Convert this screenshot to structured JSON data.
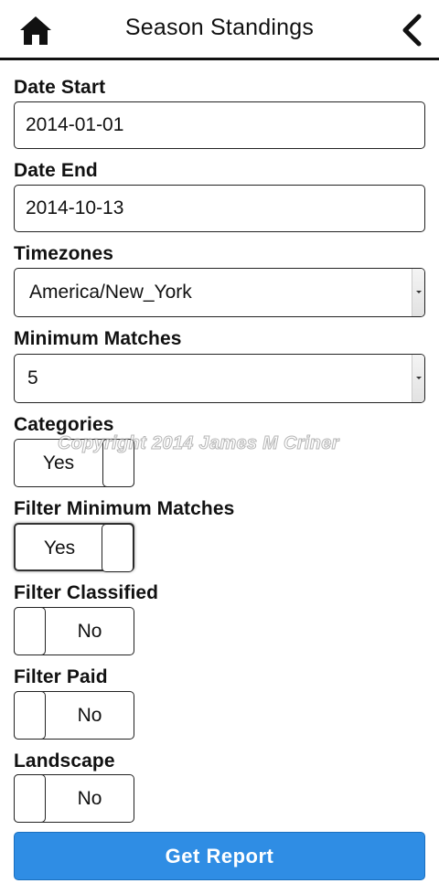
{
  "header": {
    "title": "Season Standings",
    "home_icon": "home-icon",
    "back_icon": "chevron-left-icon"
  },
  "form": {
    "date_start": {
      "label": "Date Start",
      "value": "2014-01-01"
    },
    "date_end": {
      "label": "Date End",
      "value": "2014-10-13"
    },
    "timezones": {
      "label": "Timezones",
      "selected": "America/New_York"
    },
    "minimum_matches": {
      "label": "Minimum Matches",
      "selected": "5"
    },
    "categories": {
      "label": "Categories",
      "state": "Yes"
    },
    "filter_minimum_matches": {
      "label": "Filter Minimum Matches",
      "state": "Yes"
    },
    "filter_classified": {
      "label": "Filter Classified",
      "state": "No"
    },
    "filter_paid": {
      "label": "Filter Paid",
      "state": "No"
    },
    "landscape": {
      "label": "Landscape",
      "state": "No"
    }
  },
  "watermark": "Copyright 2014 James M Criner",
  "actions": {
    "get_report": "Get Report"
  },
  "colors": {
    "accent": "#2f8de4",
    "header_rule": "#111111"
  }
}
